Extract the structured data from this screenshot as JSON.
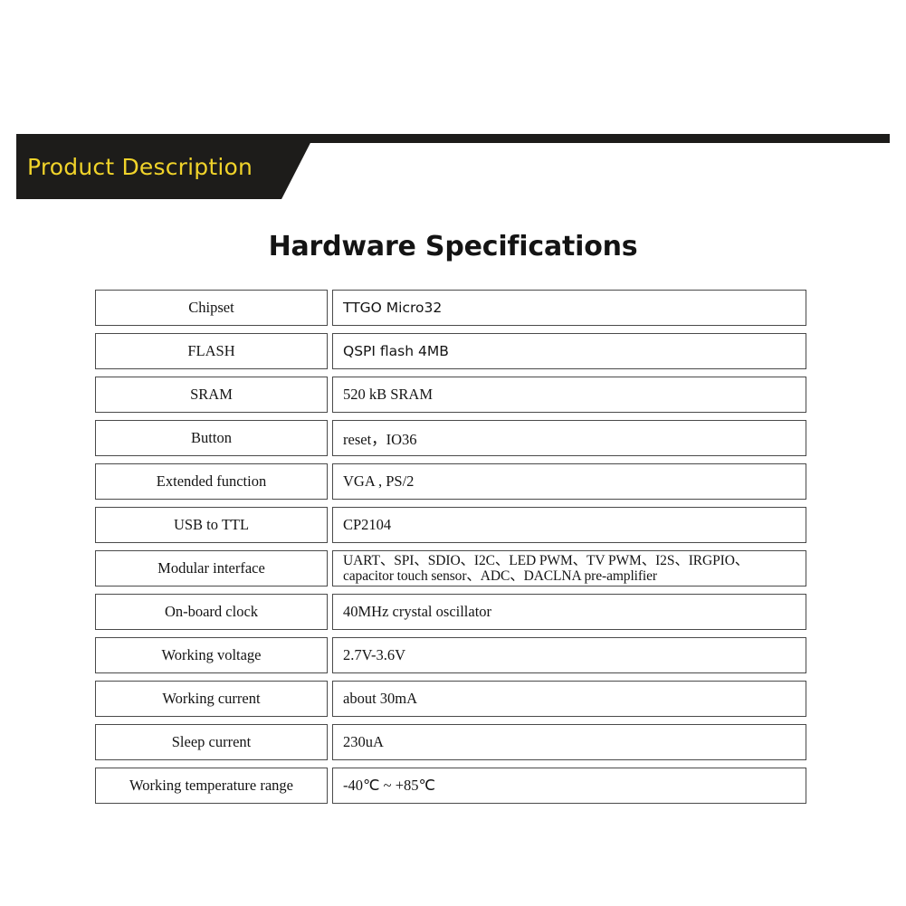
{
  "banner": {
    "title": "Product Description",
    "title_color": "#f0d32a",
    "background_color": "#1d1c1a"
  },
  "section": {
    "heading": "Hardware Specifications"
  },
  "spec_table": {
    "rows": [
      {
        "key": "Chipset",
        "value": "TTGO Micro32",
        "value_style": "sans"
      },
      {
        "key": "FLASH",
        "value": "QSPI flash 4MB",
        "value_style": "sans"
      },
      {
        "key": "SRAM",
        "value": "520 kB SRAM",
        "value_style": "serif"
      },
      {
        "key": "Button",
        "value": "reset，IO36",
        "value_style": "serif"
      },
      {
        "key": "Extended function",
        "value": "VGA , PS/2",
        "value_style": "serif"
      },
      {
        "key": "USB to TTL",
        "value": "CP2104",
        "value_style": "serif"
      },
      {
        "key": "Modular interface",
        "value_line1": "UART、SPI、SDIO、I2C、LED PWM、TV PWM、I2S、IRGPIO、",
        "value_line2": "capacitor touch sensor、ADC、DACLNA pre-amplifier",
        "value_style": "serif-two-line"
      },
      {
        "key": "On-board clock",
        "value": "40MHz crystal oscillator",
        "value_style": "serif"
      },
      {
        "key": "Working voltage",
        "value": "2.7V-3.6V",
        "value_style": "serif"
      },
      {
        "key": "Working current",
        "value": "about 30mA",
        "value_style": "serif"
      },
      {
        "key": "Sleep current",
        "value": "230uA",
        "value_style": "serif"
      },
      {
        "key": "Working temperature range",
        "value": "-40℃ ~ +85℃",
        "value_style": "serif"
      }
    ]
  }
}
